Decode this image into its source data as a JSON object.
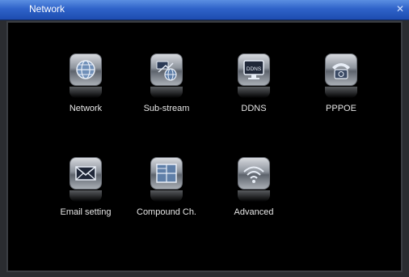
{
  "window": {
    "title": "Network",
    "close_icon": "close-icon"
  },
  "items": [
    {
      "label": "Network",
      "icon": "globe-icon"
    },
    {
      "label": "Sub-stream",
      "icon": "substream-icon"
    },
    {
      "label": "DDNS",
      "icon": "ddns-monitor-icon",
      "badge": "DDNS"
    },
    {
      "label": "PPPOE",
      "icon": "telephone-icon"
    },
    {
      "label": "Email setting",
      "icon": "envelope-icon"
    },
    {
      "label": "Compound Ch.",
      "icon": "grid-layout-icon"
    },
    {
      "label": "Advanced",
      "icon": "wifi-icon"
    }
  ],
  "colors": {
    "titlebar": "#2f63c9",
    "background": "#000000",
    "label": "#e6e6e6"
  }
}
